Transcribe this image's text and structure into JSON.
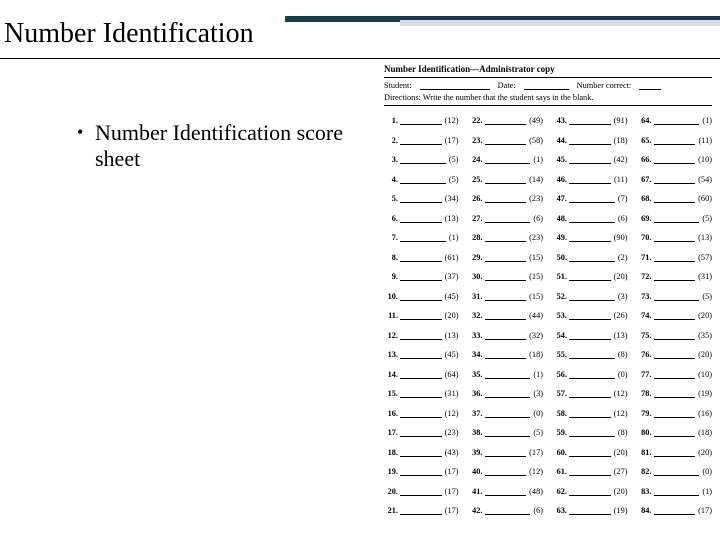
{
  "title": "Number Identification",
  "bullet": "Number Identification score sheet",
  "sheet": {
    "header": "Number Identification—Administrator copy",
    "meta": {
      "student_label": "Student:",
      "date_label": "Date:",
      "correct_label": "Number correct:"
    },
    "directions": "Directions: Write the number that the student says in the blank.",
    "items": [
      {
        "n": 1,
        "v": 12
      },
      {
        "n": 2,
        "v": 17
      },
      {
        "n": 3,
        "v": 5
      },
      {
        "n": 4,
        "v": 5
      },
      {
        "n": 5,
        "v": 34
      },
      {
        "n": 6,
        "v": 13
      },
      {
        "n": 7,
        "v": 1
      },
      {
        "n": 8,
        "v": 61
      },
      {
        "n": 9,
        "v": 37
      },
      {
        "n": 10,
        "v": 45
      },
      {
        "n": 11,
        "v": 20
      },
      {
        "n": 12,
        "v": 13
      },
      {
        "n": 13,
        "v": 45
      },
      {
        "n": 14,
        "v": 64
      },
      {
        "n": 15,
        "v": 31
      },
      {
        "n": 16,
        "v": 12
      },
      {
        "n": 17,
        "v": 23
      },
      {
        "n": 18,
        "v": 43
      },
      {
        "n": 19,
        "v": 17
      },
      {
        "n": 20,
        "v": 17
      },
      {
        "n": 21,
        "v": 17
      },
      {
        "n": 22,
        "v": 49
      },
      {
        "n": 23,
        "v": 58
      },
      {
        "n": 24,
        "v": 1
      },
      {
        "n": 25,
        "v": 14
      },
      {
        "n": 26,
        "v": 23
      },
      {
        "n": 27,
        "v": 6
      },
      {
        "n": 28,
        "v": 23
      },
      {
        "n": 29,
        "v": 15
      },
      {
        "n": 30,
        "v": 15
      },
      {
        "n": 31,
        "v": 15
      },
      {
        "n": 32,
        "v": 44
      },
      {
        "n": 33,
        "v": 32
      },
      {
        "n": 34,
        "v": 18
      },
      {
        "n": 35,
        "v": 1
      },
      {
        "n": 36,
        "v": 3
      },
      {
        "n": 37,
        "v": 0
      },
      {
        "n": 38,
        "v": 5
      },
      {
        "n": 39,
        "v": 17
      },
      {
        "n": 40,
        "v": 12
      },
      {
        "n": 41,
        "v": 48
      },
      {
        "n": 42,
        "v": 6
      },
      {
        "n": 43,
        "v": 91
      },
      {
        "n": 44,
        "v": 18
      },
      {
        "n": 45,
        "v": 42
      },
      {
        "n": 46,
        "v": 11
      },
      {
        "n": 47,
        "v": 7
      },
      {
        "n": 48,
        "v": 6
      },
      {
        "n": 49,
        "v": 90
      },
      {
        "n": 50,
        "v": 2
      },
      {
        "n": 51,
        "v": 20
      },
      {
        "n": 52,
        "v": 3
      },
      {
        "n": 53,
        "v": 26
      },
      {
        "n": 54,
        "v": 13
      },
      {
        "n": 55,
        "v": 8
      },
      {
        "n": 56,
        "v": 0
      },
      {
        "n": 57,
        "v": 12
      },
      {
        "n": 58,
        "v": 12
      },
      {
        "n": 59,
        "v": 8
      },
      {
        "n": 60,
        "v": 20
      },
      {
        "n": 61,
        "v": 27
      },
      {
        "n": 62,
        "v": 20
      },
      {
        "n": 63,
        "v": 19
      },
      {
        "n": 64,
        "v": 1
      },
      {
        "n": 65,
        "v": 11
      },
      {
        "n": 66,
        "v": 10
      },
      {
        "n": 67,
        "v": 54
      },
      {
        "n": 68,
        "v": 60
      },
      {
        "n": 69,
        "v": 5
      },
      {
        "n": 70,
        "v": 13
      },
      {
        "n": 71,
        "v": 57
      },
      {
        "n": 72,
        "v": 31
      },
      {
        "n": 73,
        "v": 5
      },
      {
        "n": 74,
        "v": 20
      },
      {
        "n": 75,
        "v": 35
      },
      {
        "n": 76,
        "v": 20
      },
      {
        "n": 77,
        "v": 10
      },
      {
        "n": 78,
        "v": 19
      },
      {
        "n": 79,
        "v": 16
      },
      {
        "n": 80,
        "v": 18
      },
      {
        "n": 81,
        "v": 20
      },
      {
        "n": 82,
        "v": 0
      },
      {
        "n": 83,
        "v": 1
      },
      {
        "n": 84,
        "v": 17
      }
    ]
  }
}
